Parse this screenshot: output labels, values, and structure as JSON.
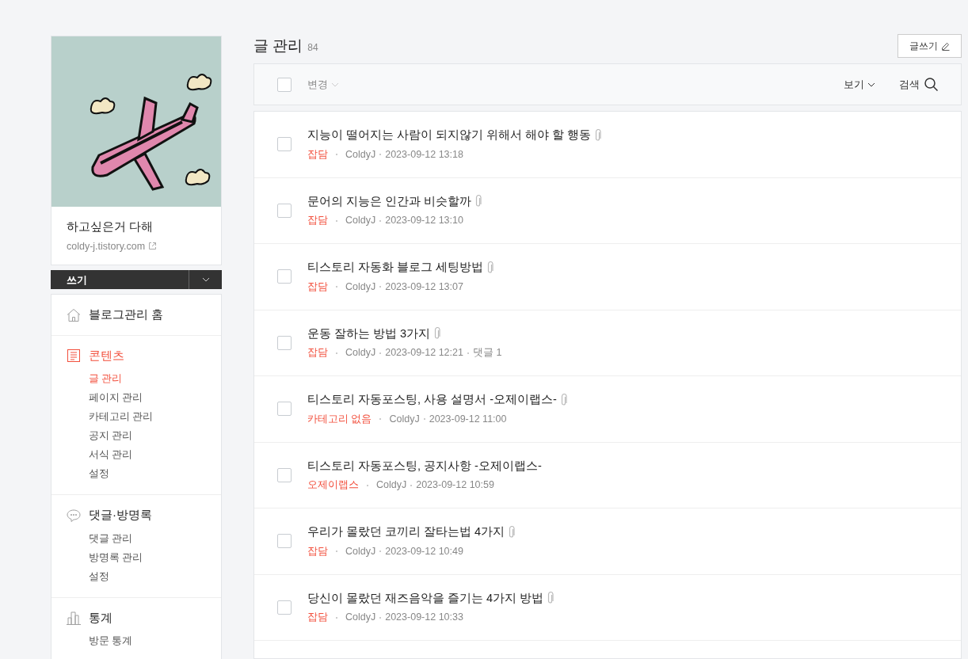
{
  "blog": {
    "name": "하고싶은거 다해",
    "url": "coldy-j.tistory.com"
  },
  "write_menu": {
    "label": "쓰기"
  },
  "nav": [
    {
      "kind": "home",
      "title": "블로그관리 홈",
      "selected": false
    },
    {
      "kind": "content",
      "title": "콘텐츠",
      "selected": true,
      "children": [
        {
          "label": "글 관리",
          "selected": true
        },
        {
          "label": "페이지 관리",
          "selected": false
        },
        {
          "label": "카테고리 관리",
          "selected": false
        },
        {
          "label": "공지 관리",
          "selected": false
        },
        {
          "label": "서식 관리",
          "selected": false
        },
        {
          "label": "설정",
          "selected": false
        }
      ]
    },
    {
      "kind": "comment",
      "title": "댓글·방명록",
      "selected": false,
      "children": [
        {
          "label": "댓글 관리",
          "selected": false
        },
        {
          "label": "방명록 관리",
          "selected": false
        },
        {
          "label": "설정",
          "selected": false
        }
      ]
    },
    {
      "kind": "stats",
      "title": "통계",
      "selected": false,
      "children": [
        {
          "label": "방문 통계",
          "selected": false
        }
      ]
    }
  ],
  "page": {
    "title": "글 관리",
    "count": "84",
    "write_button": "글쓰기"
  },
  "toolbar": {
    "change": "변경",
    "view": "보기",
    "search": "검색",
    "select_all_checked": false
  },
  "posts": [
    {
      "title": "지능이 떨어지는 사람이 되지않기 위해서 해야 할 행동",
      "attachment": true,
      "category": "잡담",
      "author": "ColdyJ",
      "date": "2023-09-12 13:18",
      "checked": false
    },
    {
      "title": "문어의 지능은 인간과 비슷할까",
      "attachment": true,
      "category": "잡담",
      "author": "ColdyJ",
      "date": "2023-09-12 13:10",
      "checked": false
    },
    {
      "title": "티스토리 자동화 블로그 세팅방법",
      "attachment": true,
      "category": "잡담",
      "author": "ColdyJ",
      "date": "2023-09-12 13:07",
      "checked": false
    },
    {
      "title": "운동 잘하는 방법 3가지",
      "attachment": true,
      "category": "잡담",
      "author": "ColdyJ",
      "date": "2023-09-12 12:21",
      "comments": "댓글 1",
      "checked": false
    },
    {
      "title": "티스토리 자동포스팅, 사용 설명서 -오제이랩스-",
      "attachment": true,
      "category": "카테고리 없음",
      "author": "ColdyJ",
      "date": "2023-09-12 11:00",
      "checked": false
    },
    {
      "title": "티스토리 자동포스팅, 공지사항 -오제이랩스-",
      "attachment": false,
      "category": "오제이랩스",
      "author": "ColdyJ",
      "date": "2023-09-12 10:59",
      "checked": false
    },
    {
      "title": "우리가 몰랐던 코끼리 잘타는법 4가지",
      "attachment": true,
      "category": "잡담",
      "author": "ColdyJ",
      "date": "2023-09-12 10:49",
      "checked": false
    },
    {
      "title": "당신이 몰랐던 재즈음악을 즐기는 4가지 방법",
      "attachment": true,
      "category": "잡담",
      "author": "ColdyJ",
      "date": "2023-09-12 10:33",
      "checked": false
    }
  ]
}
